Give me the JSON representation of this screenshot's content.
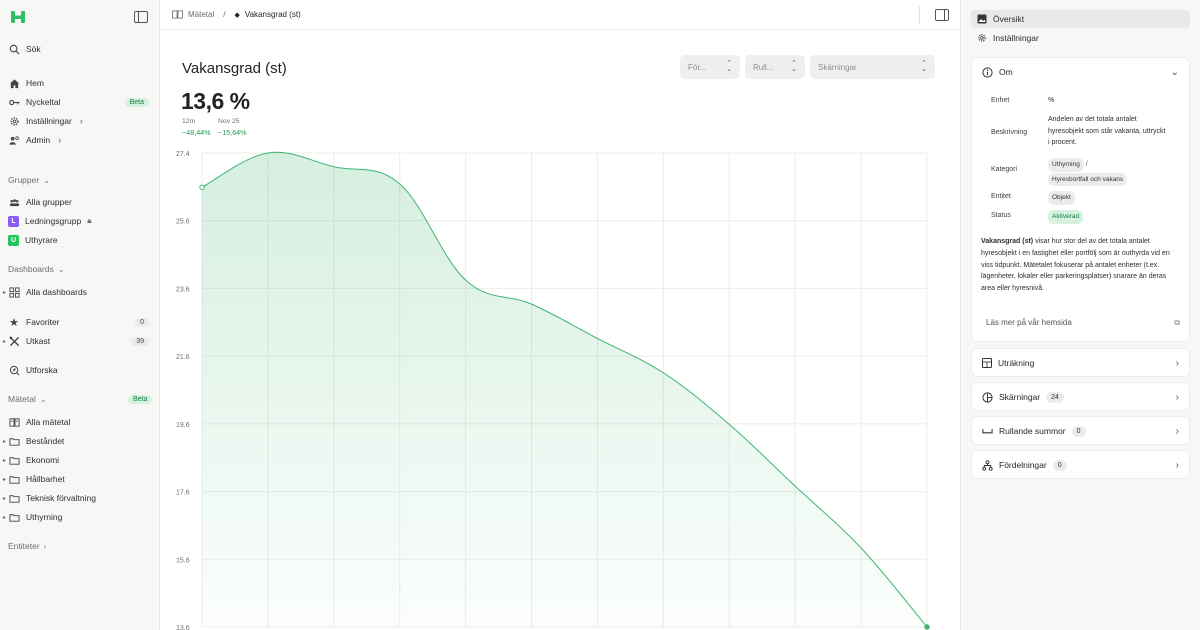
{
  "sidebar": {
    "search": "Sök",
    "nav": [
      {
        "label": "Hem",
        "icon": "home-icon"
      },
      {
        "label": "Nyckeltal",
        "icon": "key-icon",
        "badge": "Beta"
      },
      {
        "label": "Inställningar",
        "icon": "gear-icon"
      },
      {
        "label": "Admin",
        "icon": "users-icon"
      }
    ],
    "groups_title": "Grupper",
    "groups": [
      {
        "label": "Alla grupper",
        "icon": "people-icon"
      },
      {
        "label": "Ledningsgrupp",
        "letter": "L",
        "color": "#8b5cf6"
      },
      {
        "label": "Uthyrare",
        "letter": "U",
        "color": "#22c55e"
      }
    ],
    "dashboards_title": "Dashboards",
    "dashboards": [
      {
        "label": "Alla dashboards"
      }
    ],
    "favorites": {
      "label": "Favoriter",
      "count": "0"
    },
    "drafts": {
      "label": "Utkast",
      "count": "39"
    },
    "explore": "Utforska",
    "metrics_title": "Mätetal",
    "metrics_badge": "Beta",
    "metrics": [
      "Alla mätetal",
      "Beståndet",
      "Ekonomi",
      "Hållbarhet",
      "Teknisk förvaltning",
      "Uthyrning"
    ],
    "entities_title": "Entiteter"
  },
  "topbar": {
    "crumb_parent": "Mätetal",
    "separator": "/",
    "crumb_current": "Vakansgrad (st)"
  },
  "main": {
    "title": "Vakansgrad (st)",
    "value": "13,6 %",
    "deltas": [
      {
        "label": "12m",
        "value": "−48,44%"
      },
      {
        "label": "Nov 25",
        "value": "−15,64%"
      }
    ],
    "selects": [
      {
        "label": "För..."
      },
      {
        "label": "Rull..."
      },
      {
        "label": "Skärningar"
      }
    ]
  },
  "chart_data": {
    "type": "area",
    "y_ticks": [
      "27.4",
      "25.6",
      "23.6",
      "21.6",
      "19.6",
      "17.6",
      "15.6",
      "13.6"
    ],
    "ylim": [
      13.6,
      27.4
    ],
    "x": [
      0,
      1,
      2,
      3,
      4,
      5,
      6,
      7,
      8,
      9,
      10,
      11
    ],
    "values": [
      26.4,
      27.4,
      27.0,
      26.5,
      23.7,
      23.0,
      22.0,
      21.0,
      19.5,
      17.7,
      15.9,
      13.6
    ],
    "grid": true,
    "color": "#3fb56f"
  },
  "rpanel": {
    "tabs": [
      {
        "label": "Översikt",
        "icon": "image-icon",
        "active": true
      },
      {
        "label": "Inställningar",
        "icon": "gear-icon",
        "active": false
      }
    ],
    "about": {
      "title": "Om",
      "unit_label": "Enhet",
      "unit": "%",
      "desc_label": "Beskrivning",
      "desc_lines": [
        "Andelen av det totala antalet",
        "hyresobjekt som står vakanta, uttryckt",
        "i procent."
      ],
      "category_label": "Kategori",
      "category_tags": [
        "Uthyrning",
        "Hyresbortfall och vakans"
      ],
      "entity_label": "Entitet",
      "entity": "Objekt",
      "status_label": "Status",
      "status": "Aktiverad",
      "para_bold": "Vakansgrad (st)",
      "para_lines": [
        " visar hur stor del av det totala antalet",
        "hyresobjekt i en fastighet eller portfölj som är outhyrda vid en",
        "viss tidpunkt. Mätetalet fokuserar på antalet enheter (t.ex.",
        "lägenheter, lokaler eller parkeringsplatser) snarare än deras",
        "area eller hyresnivå."
      ],
      "link": "Läs mer på vår hemsida"
    },
    "sections": [
      {
        "label": "Uträkning",
        "icon": "calc-icon"
      },
      {
        "label": "Skärningar",
        "icon": "pie-icon",
        "count": "24"
      },
      {
        "label": "Rullande summor",
        "icon": "bracket-icon",
        "count": "0"
      },
      {
        "label": "Fördelningar",
        "icon": "tree-icon",
        "count": "0"
      }
    ]
  }
}
